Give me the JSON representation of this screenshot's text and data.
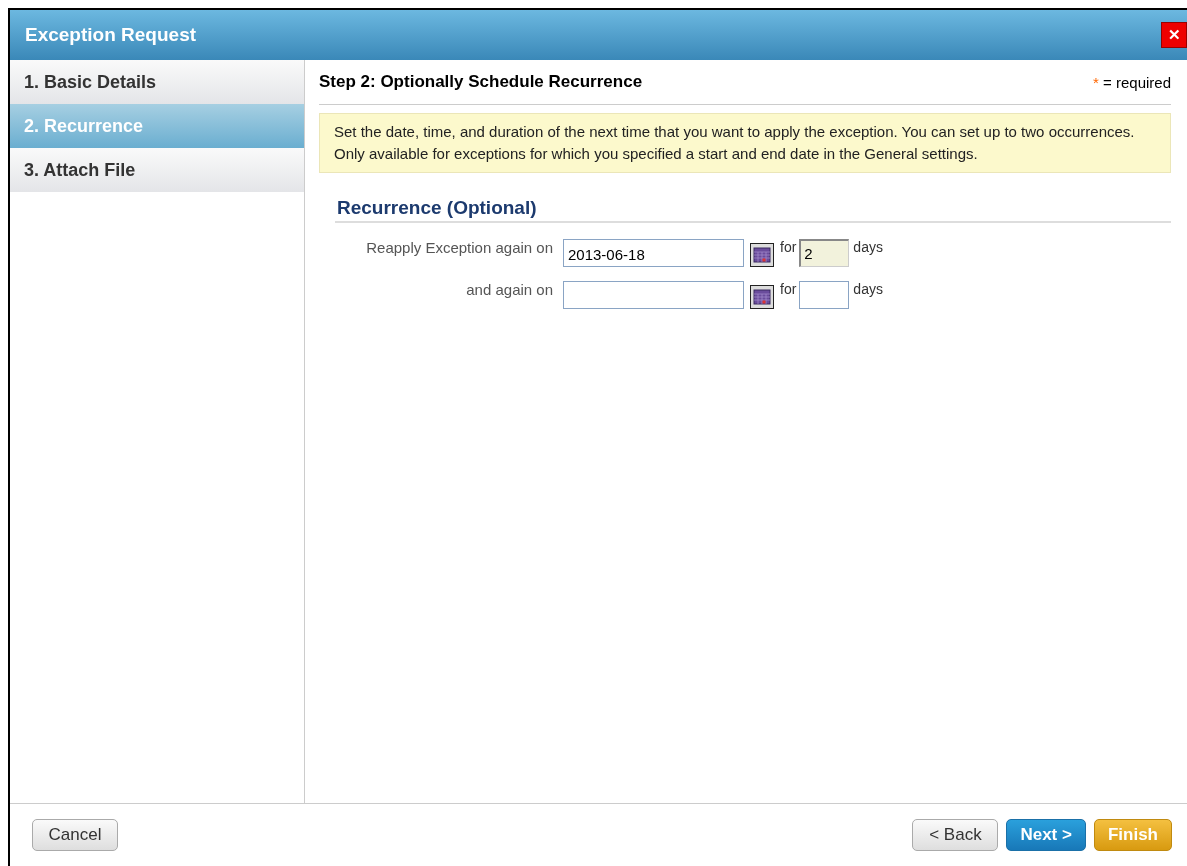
{
  "window": {
    "title": "Exception Request",
    "close_label": "✕"
  },
  "steps": [
    {
      "label": "1. Basic Details",
      "selected": false
    },
    {
      "label": "2. Recurrence",
      "selected": true
    },
    {
      "label": "3. Attach File",
      "selected": false
    }
  ],
  "header": {
    "title": "Step 2: Optionally Schedule Recurrence",
    "required_mark": "*",
    "required_text": "= required"
  },
  "info": "Set the date, time, and duration of the next time that you want to apply the exception. You can set up to two occurrences. Only available for exceptions for which you specified a start and end date in the General settings.",
  "section": {
    "title": "Recurrence (Optional)"
  },
  "rows": [
    {
      "label": "Reapply Exception again on",
      "date": "2013-06-18",
      "for": "for",
      "days": "2",
      "days_focused": true,
      "unit": "days"
    },
    {
      "label": "and again on",
      "date": "",
      "for": "for",
      "days": "",
      "days_focused": false,
      "unit": "days"
    }
  ],
  "footer": {
    "cancel": "Cancel",
    "back": "< Back",
    "next": "Next >",
    "finish": "Finish"
  }
}
